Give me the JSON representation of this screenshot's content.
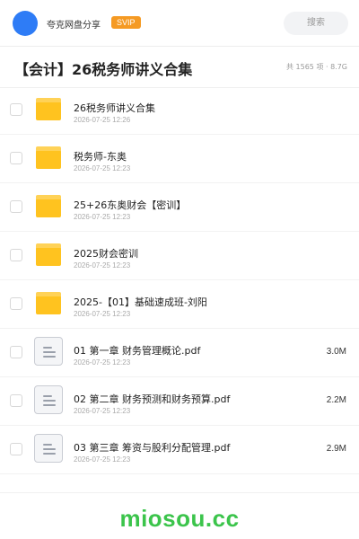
{
  "header": {
    "uploader_name": "夸克网盘分享",
    "badge": "SVIP",
    "search_placeholder": "搜索"
  },
  "share": {
    "title": "【会计】26税务师讲义合集",
    "meta": "共 1565 项 · 8.7G"
  },
  "files": [
    {
      "type": "folder",
      "name": "26税务师讲义合集",
      "date": "2026-07-25 12:26",
      "size": ""
    },
    {
      "type": "folder",
      "name": "税务师-东奥",
      "date": "2026-07-25 12:23",
      "size": ""
    },
    {
      "type": "folder",
      "name": "25+26东奥财会【密训】",
      "date": "2026-07-25 12:23",
      "size": ""
    },
    {
      "type": "folder",
      "name": "2025财会密训",
      "date": "2026-07-25 12:23",
      "size": ""
    },
    {
      "type": "folder",
      "name": "2025-【01】基础速成班-刘阳",
      "date": "2026-07-25 12:23",
      "size": ""
    },
    {
      "type": "file",
      "name": "01 第一章  财务管理概论.pdf",
      "date": "2026-07-25 12:23",
      "size": "3.0M"
    },
    {
      "type": "file",
      "name": "02 第二章 财务预测和财务预算.pdf",
      "date": "2026-07-25 12:23",
      "size": "2.2M"
    },
    {
      "type": "file",
      "name": "03 第三章  筹资与股利分配管理.pdf",
      "date": "2026-07-25 12:23",
      "size": "2.9M"
    }
  ],
  "watermark": "miosou.cc",
  "colors": {
    "accent_blue": "#2e7cf6",
    "svip_orange": "#f59a23",
    "folder_yellow": "#ffc31f",
    "watermark_green": "#3bc44b"
  }
}
